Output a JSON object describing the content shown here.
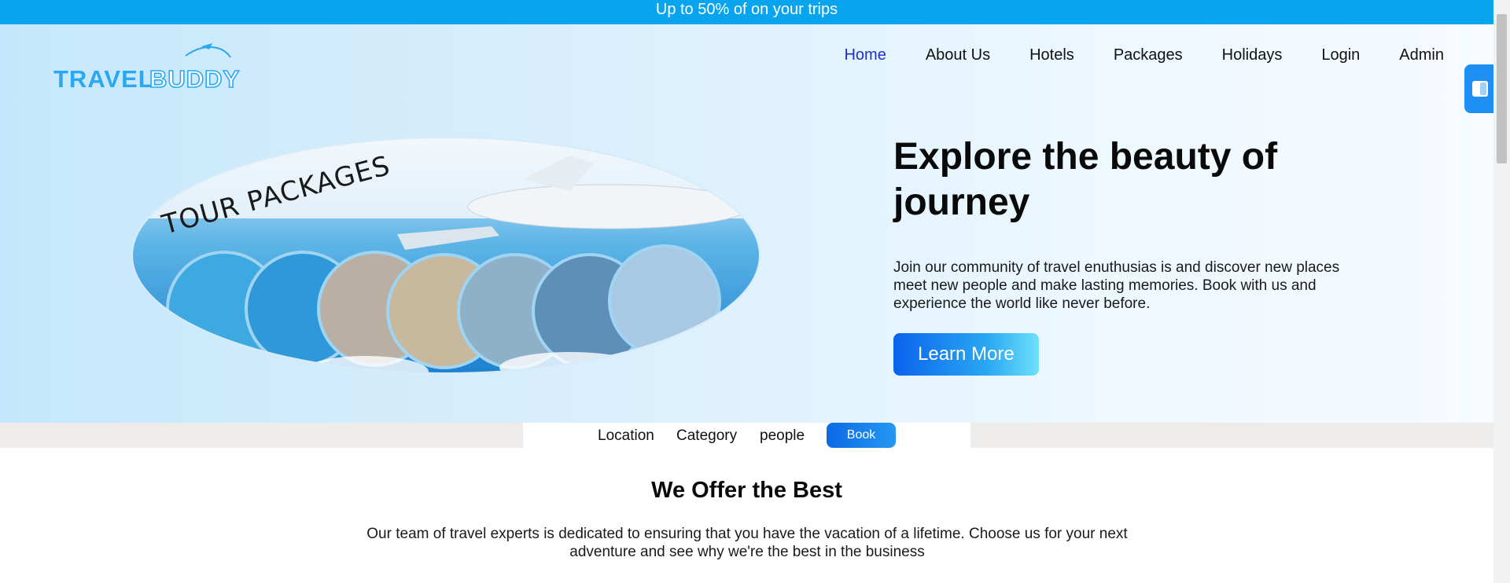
{
  "promo": {
    "text": "Up to 50% of on your trips"
  },
  "logo": {
    "text_left": "TRAVEL",
    "text_right": "BUDDY"
  },
  "nav": {
    "items": [
      {
        "label": "Home",
        "active": true
      },
      {
        "label": "About Us"
      },
      {
        "label": "Hotels"
      },
      {
        "label": "Packages"
      },
      {
        "label": "Holidays"
      },
      {
        "label": "Login"
      },
      {
        "label": "Admin"
      }
    ]
  },
  "hero": {
    "image_caption": "TOUR PACKAGES",
    "title": "Explore the beauty of journey",
    "description": "Join our community of travel enuthusias is and discover new places meet new people and make lasting memories. Book with us and experience the world like never before.",
    "cta": "Learn More"
  },
  "search": {
    "location": "Location",
    "category": "Category",
    "people": "people",
    "book": "Book"
  },
  "offer": {
    "title": "We Offer the Best",
    "description": "Our team of travel experts is dedicated to ensuring that you have the vacation of a lifetime. Choose us for your next adventure and see why we're the best in the business"
  },
  "colors": {
    "accent": "#08a4ee",
    "button": "#0a63ec",
    "nav_active": "#1c2fd4"
  },
  "icons": {
    "side_widget": "panel-toggle-icon"
  }
}
